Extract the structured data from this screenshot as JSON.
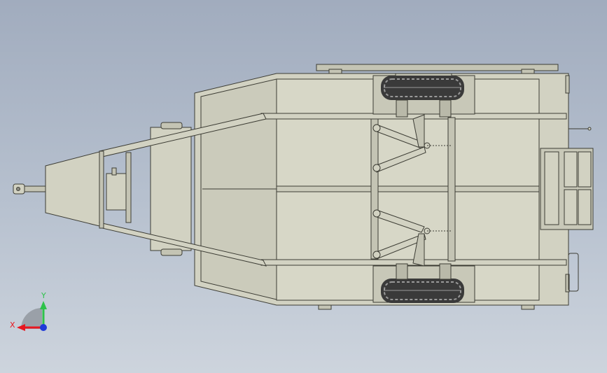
{
  "colors": {
    "background_top": "#a1acbe",
    "background_bottom": "#cdd4dd",
    "part_fill": "#d2d2c2",
    "part_fill_dark": "#b9b9a9",
    "edge": "#3c3c34",
    "tire": "#3a3a3a",
    "tire_tread": "#9a9a9a",
    "axis_x": "#e8161f",
    "axis_y": "#2ec24a",
    "axis_z": "#1f3ad8"
  },
  "triad": {
    "x_label": "X",
    "y_label": "Y"
  },
  "icons": [
    "coordinate-triad-icon"
  ]
}
